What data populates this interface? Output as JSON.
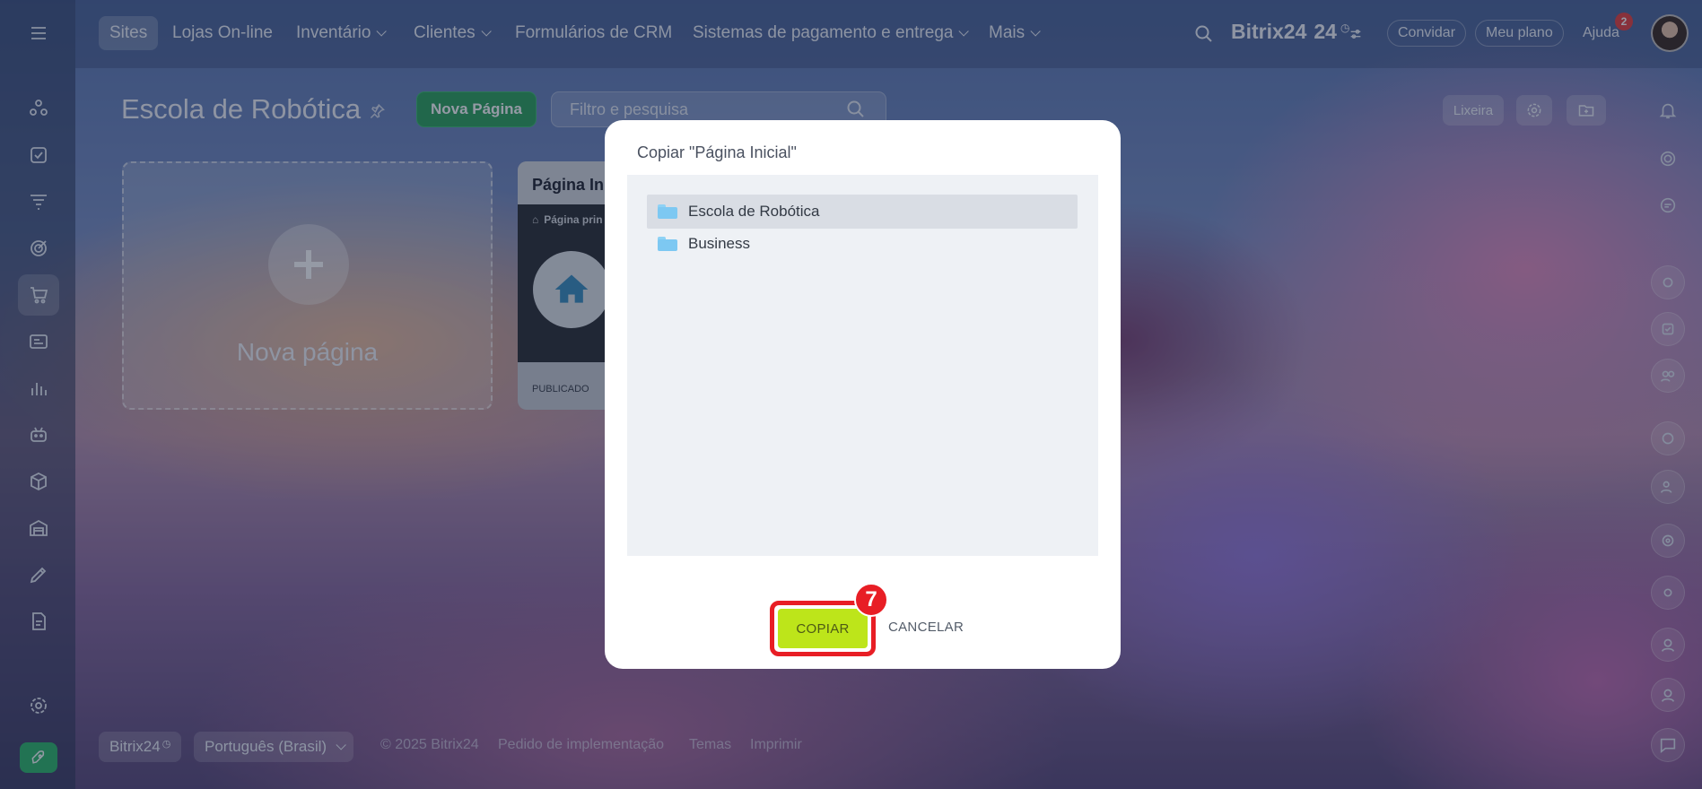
{
  "nav": {
    "items": [
      {
        "label": "Sites",
        "chevron": false
      },
      {
        "label": "Lojas On-line",
        "chevron": false
      },
      {
        "label": "Inventário",
        "chevron": true
      },
      {
        "label": "Clientes",
        "chevron": true
      },
      {
        "label": "Formulários de CRM",
        "chevron": false
      },
      {
        "label": "Sistemas de pagamento e entrega",
        "chevron": true
      },
      {
        "label": "Mais",
        "chevron": true
      }
    ],
    "brand": "Bitrix24",
    "brand_suffix": "24",
    "invite": "Convidar",
    "my_plan": "Meu plano",
    "help": "Ajuda",
    "help_badge": "2"
  },
  "page": {
    "title": "Escola de Robótica",
    "new_page_button": "Nova Página",
    "filter_placeholder": "Filtro e pesquisa",
    "trash_button": "Lixeira"
  },
  "cards": {
    "new_label": "Nova página",
    "page_title": "Página Inic",
    "page_main_label": "Página prin",
    "page_status": "PUBLICADO"
  },
  "modal": {
    "title": "Copiar \"Página Inicial\"",
    "folders": [
      "Escola de Robótica",
      "Business"
    ],
    "selected_folder_index": 0,
    "copy_button": "COPIAR",
    "cancel_button": "CANCELAR",
    "step_number": "7"
  },
  "footer": {
    "brand_button": "Bitrix24",
    "language": "Português (Brasil)",
    "copyright": "© 2025 Bitrix24",
    "implementation": "Pedido de implementação",
    "themes": "Temas",
    "print": "Imprimir"
  },
  "colors": {
    "primary_green": "#2da25b",
    "copy_button_lime": "#bde51a",
    "highlight_red": "#e81e25",
    "folder_blue": "#7dc8f2"
  }
}
